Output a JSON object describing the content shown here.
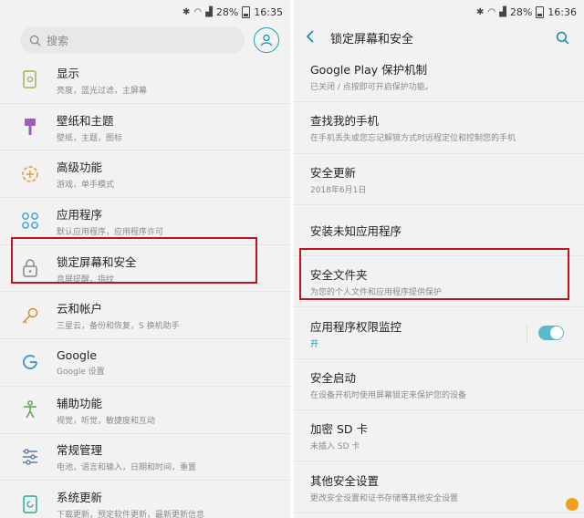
{
  "status": {
    "battery": "28%",
    "time_left": "16:35",
    "time_right": "16:36"
  },
  "left": {
    "search_placeholder": "搜索",
    "items": [
      {
        "title": "显示",
        "subtitle": "亮度，蓝光过滤，主屏幕",
        "icon": "display-icon"
      },
      {
        "title": "壁纸和主题",
        "subtitle": "壁纸，主题，图标",
        "icon": "brush-icon"
      },
      {
        "title": "高级功能",
        "subtitle": "游戏，单手模式",
        "icon": "advanced-features-icon"
      },
      {
        "title": "应用程序",
        "subtitle": "默认应用程序，应用程序许可",
        "icon": "apps-icon"
      },
      {
        "title": "锁定屏幕和安全",
        "subtitle": "息屏提醒，指纹",
        "icon": "lock-icon"
      },
      {
        "title": "云和帐户",
        "subtitle": "三星云，备份和恢复，S 换机助手",
        "icon": "key-icon"
      },
      {
        "title": "Google",
        "subtitle": "Google 设置",
        "icon": "google-icon"
      },
      {
        "title": "辅助功能",
        "subtitle": "视觉，听觉，敏捷度和互动",
        "icon": "accessibility-icon"
      },
      {
        "title": "常规管理",
        "subtitle": "电池，语言和输入，日期和时间，重置",
        "icon": "sliders-icon"
      },
      {
        "title": "系统更新",
        "subtitle": "下载更新，预定软件更新，最新更新信息",
        "icon": "update-icon"
      }
    ]
  },
  "right": {
    "title": "锁定屏幕和安全",
    "items": [
      {
        "title": "Google Play 保护机制",
        "subtitle": "已关闭 / 点按即可开启保护功能。"
      },
      {
        "title": "查找我的手机",
        "subtitle": "在手机丢失或您忘记解锁方式时远程定位和控制您的手机"
      },
      {
        "title": "安全更新",
        "subtitle": "2018年6月1日"
      },
      {
        "title": "安装未知应用程序",
        "subtitle": ""
      },
      {
        "title": "安全文件夹",
        "subtitle": "为您的个人文件和应用程序提供保护"
      },
      {
        "title": "应用程序权限监控",
        "subtitle": "开",
        "toggle_on": true
      },
      {
        "title": "安全启动",
        "subtitle": "在设备开机时使用屏幕锁定来保护您的设备"
      },
      {
        "title": "加密 SD 卡",
        "subtitle": "未插入 SD 卡"
      },
      {
        "title": "其他安全设置",
        "subtitle": "更改安全设置和证书存储等其他安全设置"
      }
    ]
  },
  "colors": {
    "accent": "#1a8ea6",
    "highlight": "#c1121f",
    "toggle": "#59b8cc"
  }
}
